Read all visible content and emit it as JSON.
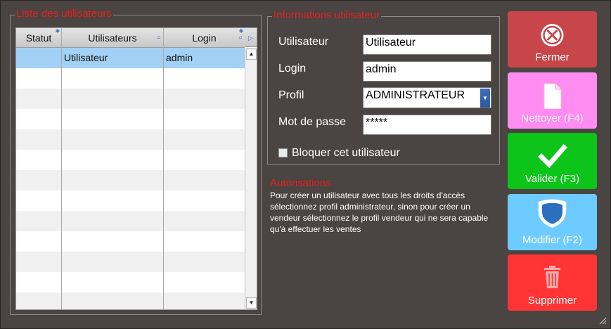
{
  "users_list": {
    "title": "Liste des utilisateurs",
    "columns": [
      "Statut",
      "Utilisateurs",
      "Login"
    ],
    "rows": [
      {
        "statut": "",
        "utilisateur": "Utilisateur",
        "login": "admin"
      }
    ]
  },
  "user_info": {
    "title": "Informations utilisateur",
    "utilisateur_label": "Utilisateur",
    "utilisateur_value": "Utilisateur",
    "login_label": "Login",
    "login_value": "admin",
    "profil_label": "Profil",
    "profil_value": "ADMINISTRATEUR",
    "password_label": "Mot de passe",
    "password_value": "*****",
    "block_label": "Bloquer cet utilisateur"
  },
  "authorizations": {
    "title": "Autorisations",
    "text": "Pour créer un utilisateur avec tous les droits d'accès sélectionnez profil administrateur, sinon pour créer un vendeur sélectionnez le profil vendeur qui ne sera capable qu'à effectuer les ventes"
  },
  "actions": {
    "close": {
      "label": "Fermer",
      "icon": "close-circle-icon",
      "color": "#c8464a"
    },
    "clear": {
      "label": "Nettoyer (F4)",
      "icon": "blank-document-icon",
      "color": "#ff8cf0"
    },
    "validate": {
      "label": "Valider (F3)",
      "icon": "checkmark-icon",
      "color": "#0cc41a"
    },
    "modify": {
      "label": "Modifier (F2)",
      "icon": "shield-icon",
      "color": "#6ecbff"
    },
    "delete": {
      "label": "Supprimer",
      "icon": "trash-icon",
      "color": "#ff3434"
    }
  }
}
